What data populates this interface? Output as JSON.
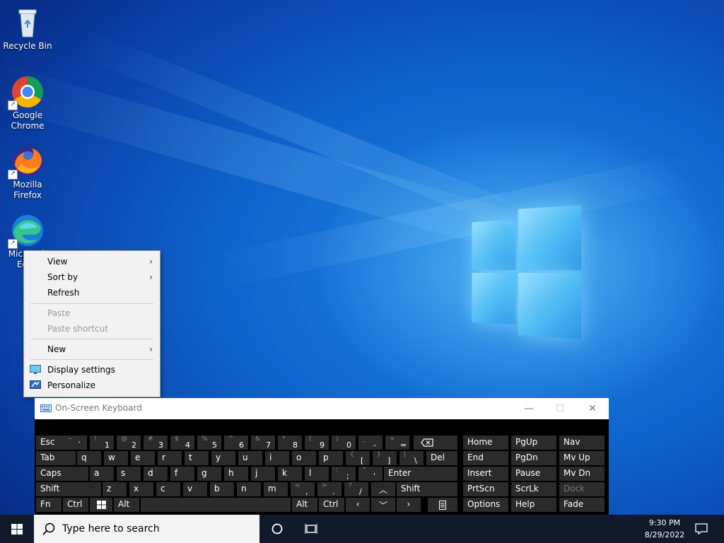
{
  "desktop": {
    "icons": [
      {
        "label": "Recycle Bin"
      },
      {
        "label": "Google Chrome"
      },
      {
        "label": "Mozilla Firefox"
      },
      {
        "label": "Microsoft Edge"
      }
    ]
  },
  "context_menu": {
    "view": "View",
    "sort_by": "Sort by",
    "refresh": "Refresh",
    "paste": "Paste",
    "paste_shortcut": "Paste shortcut",
    "new": "New",
    "display_settings": "Display settings",
    "personalize": "Personalize",
    "arrow": "›"
  },
  "osk": {
    "title": "On-Screen Keyboard",
    "minimize": "—",
    "maximize": "☐",
    "close": "✕",
    "keys": {
      "esc": "Esc",
      "tab": "Tab",
      "caps": "Caps",
      "shift": "Shift",
      "fn": "Fn",
      "ctrl": "Ctrl",
      "alt": "Alt",
      "del": "Del",
      "enter": "Enter",
      "shift_r": "Shift",
      "alt_r": "Alt",
      "ctrl_r": "Ctrl",
      "home": "Home",
      "pgup": "PgUp",
      "nav": "Nav",
      "end": "End",
      "pgdn": "PgDn",
      "mvup": "Mv Up",
      "insert": "Insert",
      "pause": "Pause",
      "mvdn": "Mv Dn",
      "prtscn": "PrtScn",
      "scrlk": "ScrLk",
      "dock": "Dock",
      "options": "Options",
      "help": "Help",
      "fade": "Fade",
      "row1": [
        {
          "top": "~",
          "main": "`"
        },
        {
          "top": "!",
          "main": "1"
        },
        {
          "top": "@",
          "main": "2"
        },
        {
          "top": "#",
          "main": "3"
        },
        {
          "top": "$",
          "main": "4"
        },
        {
          "top": "%",
          "main": "5"
        },
        {
          "top": "^",
          "main": "6"
        },
        {
          "top": "&",
          "main": "7"
        },
        {
          "top": "*",
          "main": "8"
        },
        {
          "top": "(",
          "main": "9"
        },
        {
          "top": ")",
          "main": "0"
        },
        {
          "top": "_",
          "main": "-"
        },
        {
          "top": "+",
          "main": "="
        }
      ],
      "row2": [
        "q",
        "w",
        "e",
        "r",
        "t",
        "y",
        "u",
        "i",
        "o",
        "p"
      ],
      "row2_brackets": [
        {
          "top": "{",
          "main": "["
        },
        {
          "top": "}",
          "main": "]"
        },
        {
          "top": "|",
          "main": "\\"
        }
      ],
      "row3": [
        "a",
        "s",
        "d",
        "f",
        "g",
        "h",
        "j",
        "k",
        "l"
      ],
      "row3_punct": [
        {
          "top": ":",
          "main": ";"
        },
        {
          "top": "\"",
          "main": "'"
        }
      ],
      "row4": [
        "z",
        "x",
        "c",
        "v",
        "b",
        "n",
        "m"
      ],
      "row4_punct": [
        {
          "top": "<",
          "main": ","
        },
        {
          "top": ">",
          "main": "."
        },
        {
          "top": "?",
          "main": "/"
        }
      ],
      "arrows": {
        "up": "︿",
        "down": "﹀",
        "left": "‹",
        "right": "›"
      }
    }
  },
  "taskbar": {
    "search_placeholder": "Type here to search",
    "time": "9:30 PM",
    "date": "8/29/2022"
  }
}
